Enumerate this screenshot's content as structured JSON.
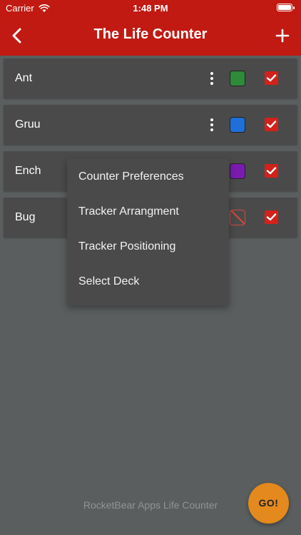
{
  "status_bar": {
    "carrier": "Carrier",
    "time": "1:48 PM"
  },
  "nav": {
    "title": "The Life Counter"
  },
  "rows": [
    {
      "name": "Ant",
      "color": "#2f8a3a",
      "checked": true,
      "has_menu": true
    },
    {
      "name": "Gruu",
      "color": "#1e6fd9",
      "checked": true,
      "has_menu": true
    },
    {
      "name": "Ench",
      "color": "#7a1bb0",
      "checked": true,
      "has_menu": true
    },
    {
      "name": "Bug",
      "color": "none",
      "checked": true,
      "has_menu": true
    }
  ],
  "menu": {
    "items": [
      "Counter Preferences",
      "Tracker Arrangment",
      "Tracker Positioning",
      "Select Deck"
    ]
  },
  "footer": {
    "text": "RocketBear Apps Life Counter"
  },
  "go_button": {
    "label": "GO!"
  },
  "colors": {
    "accent_red": "#c01a12",
    "go_orange": "#e4891d",
    "background": "#5b5e5e",
    "row_bg": "#4b4a4a"
  }
}
